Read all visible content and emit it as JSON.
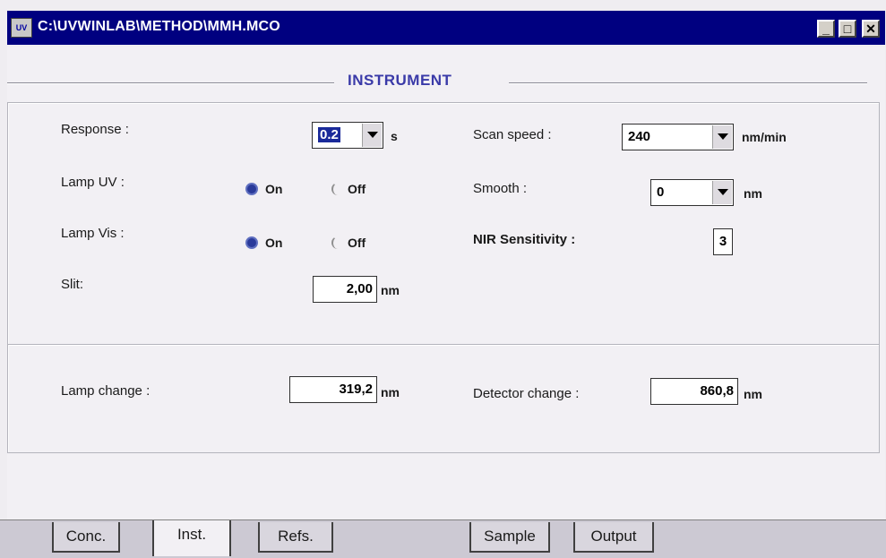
{
  "window": {
    "title": "C:\\UVWINLAB\\METHOD\\MMH.MCO",
    "icon_label": "UV",
    "controls": {
      "minimize": "_",
      "maximize": "□",
      "close": "✕"
    }
  },
  "section_title": "INSTRUMENT",
  "response": {
    "label": "Response :",
    "value": "0.2",
    "unit": "s"
  },
  "lamp_uv": {
    "label": "Lamp UV :",
    "on_label": "On",
    "off_label": "Off",
    "selected": "On"
  },
  "lamp_vis": {
    "label": "Lamp Vis :",
    "on_label": "On",
    "off_label": "Off",
    "selected": "On"
  },
  "slit": {
    "label": "Slit:",
    "value": "2,00",
    "unit": "nm"
  },
  "scan_speed": {
    "label": "Scan speed :",
    "value": "240",
    "unit": "nm/min"
  },
  "smooth": {
    "label": "Smooth :",
    "value": "0",
    "unit": "nm"
  },
  "nir_sensitivity": {
    "label": "NIR Sensitivity :",
    "value": "3"
  },
  "lamp_change": {
    "label": "Lamp change :",
    "value": "319,2",
    "unit": "nm"
  },
  "detector_change": {
    "label": "Detector change :",
    "value": "860,8",
    "unit": "nm"
  },
  "tabs": [
    {
      "label": "Conc.",
      "active": false
    },
    {
      "label": "Inst.",
      "active": true
    },
    {
      "label": "Refs.",
      "active": false
    },
    {
      "label": "Sample",
      "active": false
    },
    {
      "label": "Output",
      "active": false
    }
  ],
  "colors": {
    "titlebar": "#000080",
    "section_title": "#3a3aa8",
    "radio_selected": "#2a3a9a"
  }
}
